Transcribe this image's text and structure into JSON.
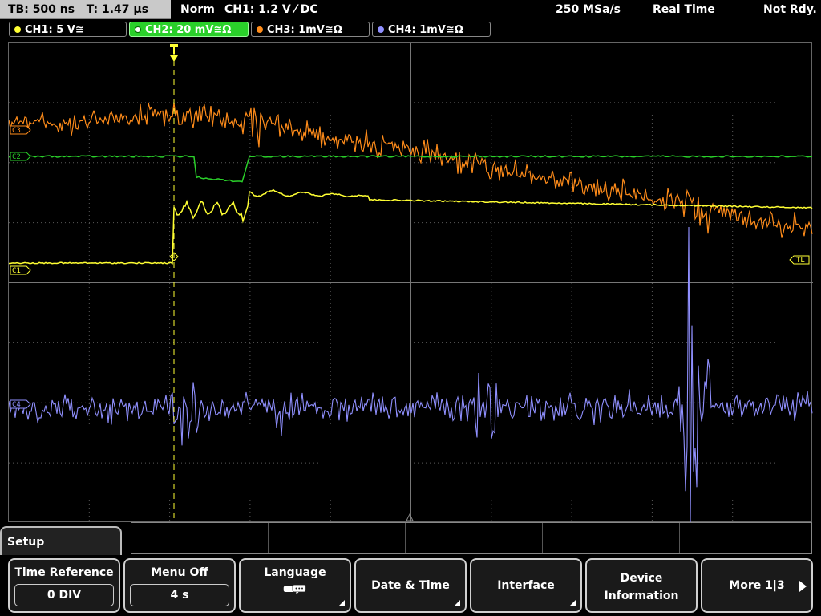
{
  "status": {
    "timebase": "TB: 500 ns",
    "trigger_time": "T: 1.47 µs",
    "mode": "Norm",
    "trigger_desc": "CH1: 1.2 V ⁄ DC",
    "sample_rate": "250 MSa/s",
    "acq_mode": "Real Time",
    "state": "Not Rdy."
  },
  "channels": [
    {
      "label": "CH1: 5 V≅",
      "color": "#ffff33"
    },
    {
      "label": "CH2: 20 mV≅Ω",
      "color": "#2ad02a"
    },
    {
      "label": "CH3: 1mV≅Ω",
      "color": "#ff8c1a"
    },
    {
      "label": "CH4: 1mV≅Ω",
      "color": "#9090ff"
    }
  ],
  "markers": {
    "ch1": "C1",
    "ch2": "C2",
    "ch3": "C3",
    "ch4": "C4",
    "trigger_level": "TL"
  },
  "menu": {
    "title": "Setup",
    "softkeys": [
      {
        "label": "Time Reference",
        "value": "0 DIV"
      },
      {
        "label": "Menu Off",
        "value": "4 s"
      },
      {
        "label": "Language",
        "value": ""
      },
      {
        "label": "Date & Time",
        "value": ""
      },
      {
        "label": "Interface",
        "value": ""
      },
      {
        "label": "Device",
        "label2": "Information"
      },
      {
        "label": "More 1|3"
      }
    ]
  },
  "colors": {
    "ch1": "#ffff33",
    "ch2": "#2ad02a",
    "ch3": "#ff8c1a",
    "ch4": "#9090ff",
    "grid": "#5a5a5a",
    "trigger_marker": "#ffff33"
  }
}
